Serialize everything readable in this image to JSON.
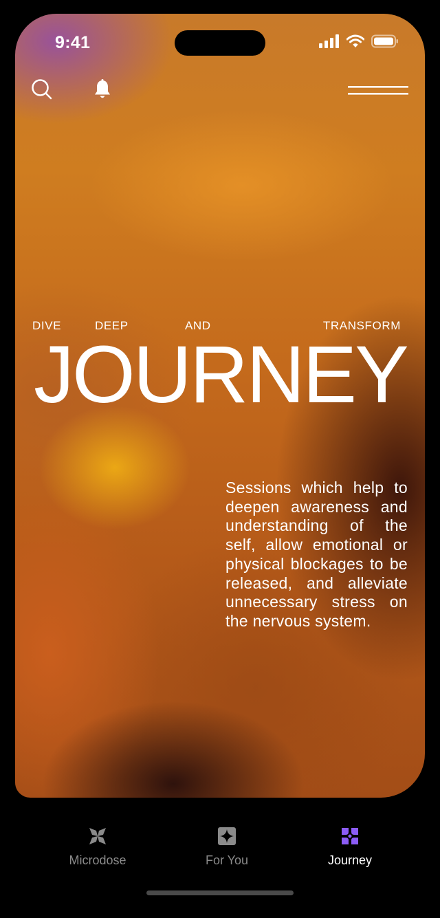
{
  "status_bar": {
    "time": "9:41"
  },
  "hero": {
    "words": [
      "DIVE",
      "DEEP",
      "AND",
      "TRANSFORM"
    ],
    "title": "JOURNEY",
    "description": "Sessions which help to deepen awareness and understanding of the self, allow emotional or physical blockages to be released, and alleviate unnecessary stress on the nervous system."
  },
  "nav": {
    "left_icons": [
      "search-icon",
      "bell-icon"
    ],
    "right_icon": "menu-icon"
  },
  "tabs": [
    {
      "label": "Microdose",
      "icon": "microdose-icon",
      "active": false
    },
    {
      "label": "For You",
      "icon": "sparkle-icon",
      "active": false
    },
    {
      "label": "Journey",
      "icon": "journey-icon",
      "active": true
    }
  ],
  "colors": {
    "accent": "#8b5cf6",
    "tab_inactive": "#8a8a8a",
    "background_warm": "#cf7d20"
  }
}
